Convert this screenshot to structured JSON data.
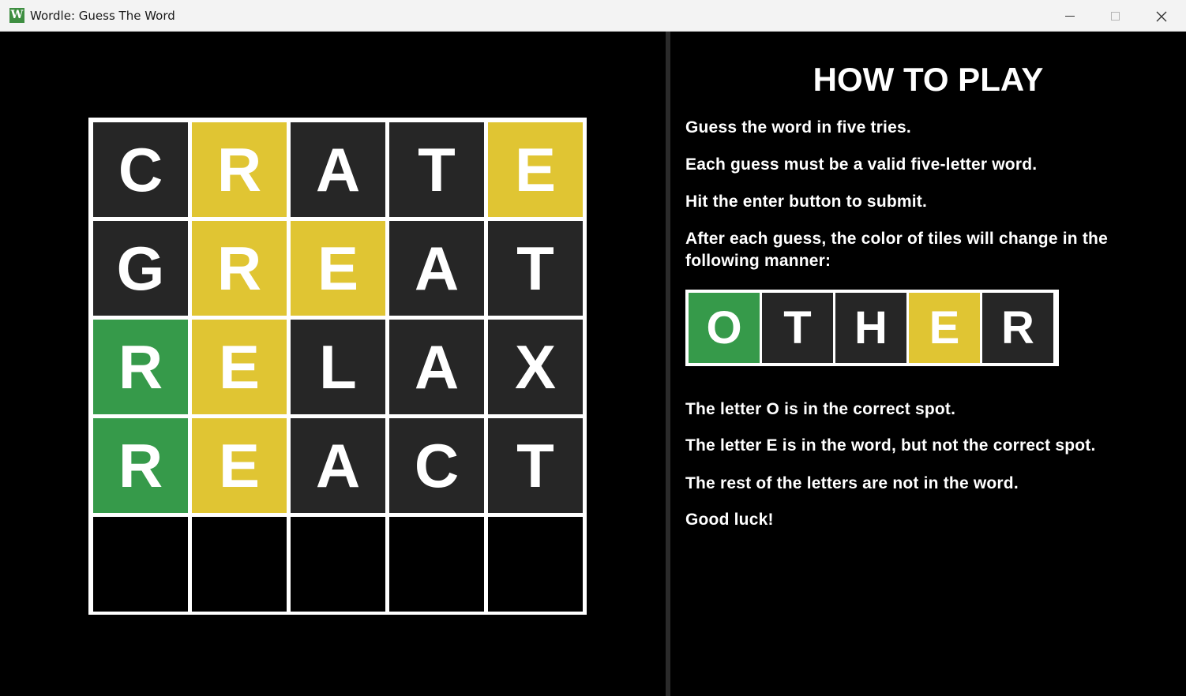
{
  "window": {
    "title": "Wordle: Guess The Word",
    "icon_letter": "W",
    "controls": [
      "minimize-icon",
      "maximize-icon",
      "close-icon"
    ]
  },
  "colors": {
    "correct": "#369a4a",
    "present": "#e0c533",
    "absent": "#262626",
    "empty": "#000000",
    "grid_border": "#ffffff"
  },
  "board": {
    "rows": [
      [
        {
          "letter": "C",
          "state": "absent"
        },
        {
          "letter": "R",
          "state": "present"
        },
        {
          "letter": "A",
          "state": "absent"
        },
        {
          "letter": "T",
          "state": "absent"
        },
        {
          "letter": "E",
          "state": "present"
        }
      ],
      [
        {
          "letter": "G",
          "state": "absent"
        },
        {
          "letter": "R",
          "state": "present"
        },
        {
          "letter": "E",
          "state": "present"
        },
        {
          "letter": "A",
          "state": "absent"
        },
        {
          "letter": "T",
          "state": "absent"
        }
      ],
      [
        {
          "letter": "R",
          "state": "correct"
        },
        {
          "letter": "E",
          "state": "present"
        },
        {
          "letter": "L",
          "state": "absent"
        },
        {
          "letter": "A",
          "state": "absent"
        },
        {
          "letter": "X",
          "state": "absent"
        }
      ],
      [
        {
          "letter": "R",
          "state": "correct"
        },
        {
          "letter": "E",
          "state": "present"
        },
        {
          "letter": "A",
          "state": "absent"
        },
        {
          "letter": "C",
          "state": "absent"
        },
        {
          "letter": "T",
          "state": "absent"
        }
      ],
      [
        {
          "letter": "",
          "state": "empty"
        },
        {
          "letter": "",
          "state": "empty"
        },
        {
          "letter": "",
          "state": "empty"
        },
        {
          "letter": "",
          "state": "empty"
        },
        {
          "letter": "",
          "state": "empty"
        }
      ]
    ]
  },
  "how_to_play": {
    "title": "HOW TO PLAY",
    "rules": [
      "Guess the word in five tries.",
      "Each guess must be a valid five-letter word.",
      "Hit the enter button to submit.",
      "After each guess, the color of tiles will change in the following manner:"
    ],
    "example": [
      {
        "letter": "O",
        "state": "correct"
      },
      {
        "letter": "T",
        "state": "absent"
      },
      {
        "letter": "H",
        "state": "absent"
      },
      {
        "letter": "E",
        "state": "present"
      },
      {
        "letter": "R",
        "state": "absent"
      }
    ],
    "explanations": [
      "The letter O is in the correct spot.",
      "The letter E is in the word, but not the correct spot.",
      "The rest of the letters are not in the word.",
      "Good luck!"
    ]
  }
}
